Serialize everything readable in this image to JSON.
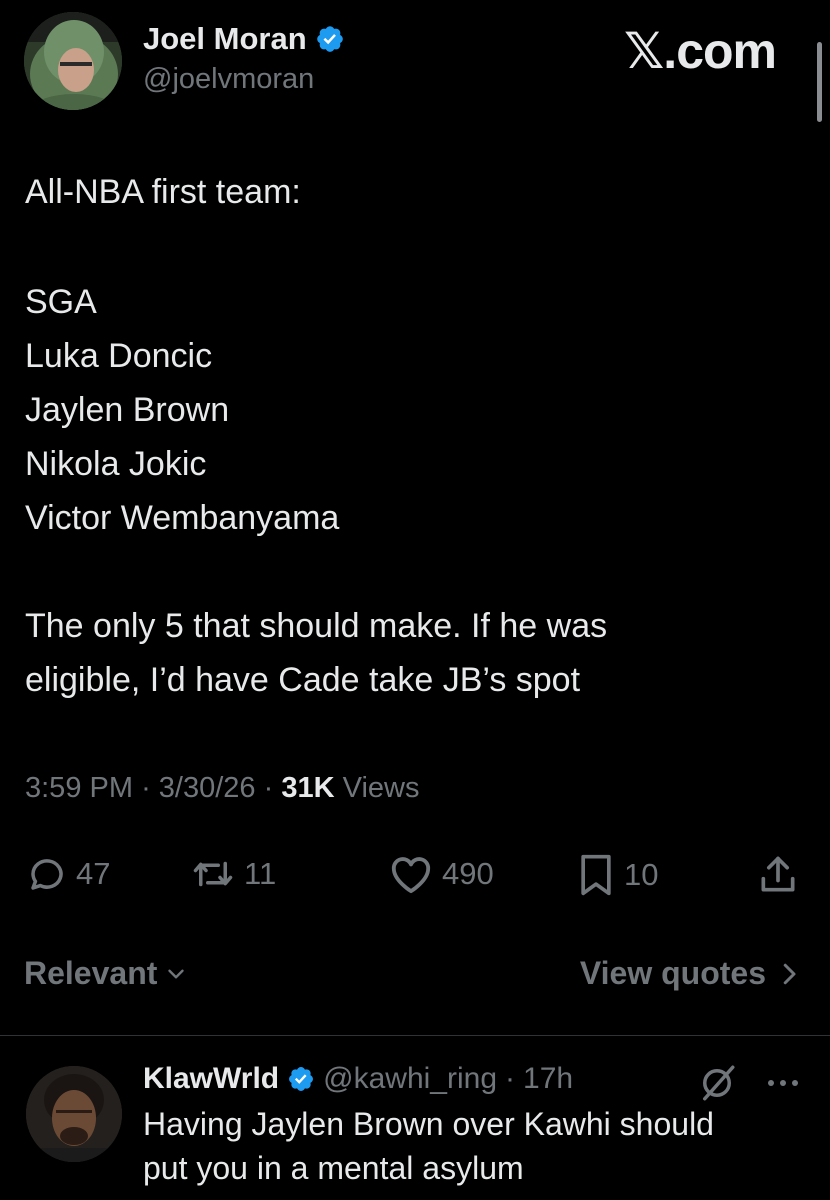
{
  "header": {
    "display_name": "Joel Moran",
    "handle": "@joelvmoran",
    "watermark_x": "𝕏",
    "watermark_suffix": ".com"
  },
  "tweet": {
    "intro": "All-NBA first team:",
    "players": [
      "SGA",
      "Luka Doncic",
      "Jaylen Brown",
      "Nikola Jokic",
      "Victor Wembanyama"
    ],
    "closing_line_1": "The only 5 that should make. If he was",
    "closing_line_2": "eligible, I’d have Cade take JB’s spot",
    "time": "3:59 PM",
    "date": "3/30/26",
    "views_count": "31K",
    "views_label": "Views",
    "separator": "·"
  },
  "actions": {
    "replies": "47",
    "reposts": "11",
    "likes": "490",
    "bookmarks": "10"
  },
  "filters": {
    "sort_label": "Relevant",
    "view_quotes_label": "View quotes"
  },
  "reply": {
    "display_name": "KlawWrld",
    "handle": "@kawhi_ring",
    "separator": "·",
    "age": "17h",
    "line_1": "Having Jaylen Brown over Kawhi should",
    "line_2": "put you in a mental asylum"
  },
  "colors": {
    "background": "#000000",
    "text_primary": "#e7e9ea",
    "text_secondary": "#71767b",
    "verified_blue": "#1d9bf0",
    "divider": "#2f3336"
  },
  "icons": {
    "verified": "verified-badge-icon",
    "reply": "reply-bubble-icon",
    "repost": "repost-icon",
    "like": "heart-icon",
    "bookmark": "bookmark-icon",
    "share": "share-icon",
    "chevron_down": "chevron-down-icon",
    "chevron_right": "chevron-right-icon",
    "grok": "grok-icon",
    "more": "more-dots-icon"
  }
}
